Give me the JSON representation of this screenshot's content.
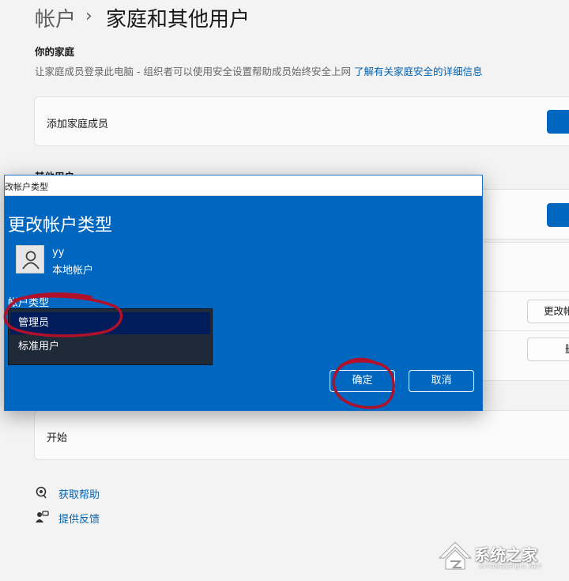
{
  "header": {
    "root": "帐户",
    "separator": "›",
    "current": "家庭和其他用户"
  },
  "family": {
    "title": "你的家庭",
    "description": "让家庭成员登录此电脑 - 组织者可以使用安全设置帮助成员始终安全上网",
    "link": "了解有关家庭安全的详细信息",
    "add_label": "添加家庭成员"
  },
  "other_users": {
    "title": "其他用户"
  },
  "account_row": {
    "change_label": "更改帐户类型",
    "remove_label": "删除"
  },
  "kiosk": {
    "start_label": "开始"
  },
  "help": {
    "get_help": "获取帮助",
    "feedback": "提供反馈"
  },
  "dialog": {
    "window_title": "改帐户类型",
    "heading": "更改帐户类型",
    "user_name": "yy",
    "user_type": "本地帐户",
    "type_label": "帐户类型",
    "options": [
      "管理员",
      "标准用户"
    ],
    "selected": "管理员",
    "ok": "确定",
    "cancel": "取消"
  },
  "watermark": {
    "text": "系统之家",
    "sub": "XITONGZHIJIA.NET"
  },
  "colors": {
    "accent": "#0067c0",
    "link": "#0062b1",
    "annotation": "#b0102a"
  }
}
